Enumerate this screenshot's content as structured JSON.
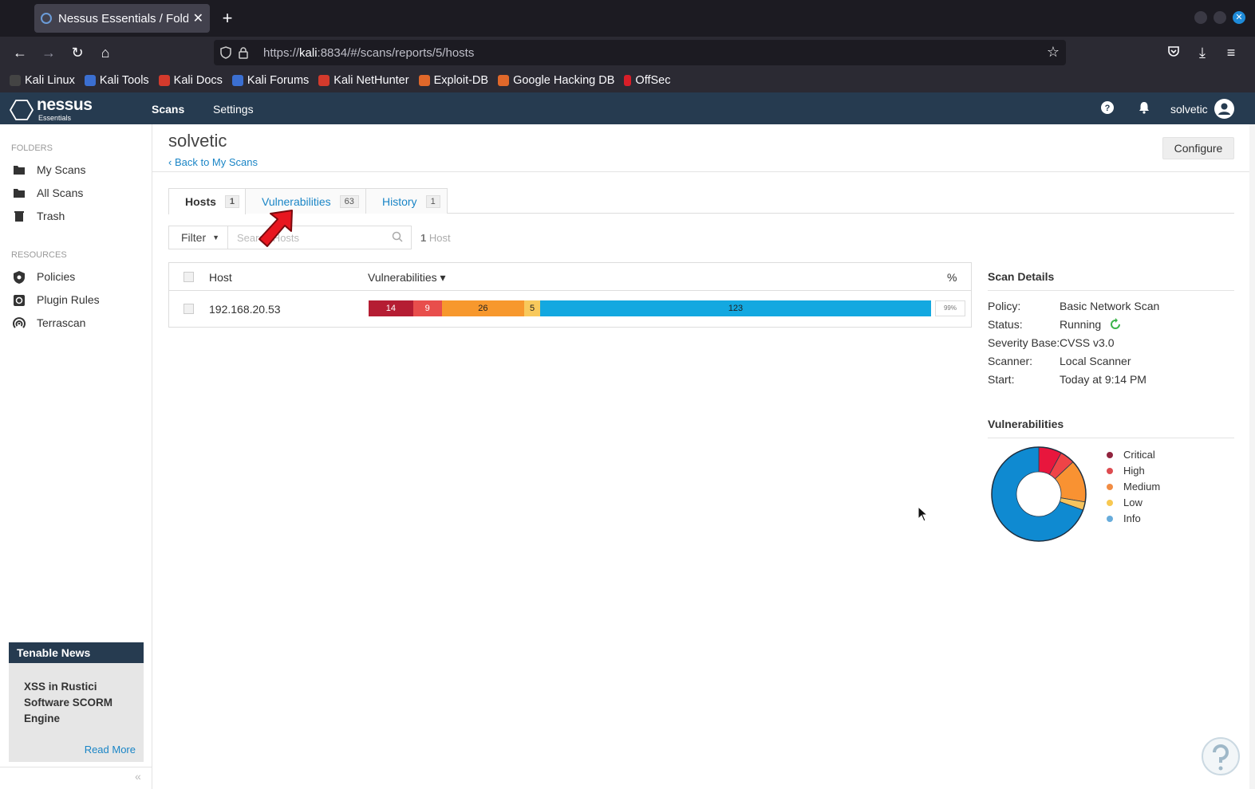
{
  "browser": {
    "tab_title": "Nessus Essentials / Folders",
    "url_prefix": "https://",
    "url_host": "kali",
    "url_rest": ":8834/#/scans/reports/5/hosts",
    "bookmarks": [
      {
        "label": "Kali Linux",
        "color": "#1b1b1b"
      },
      {
        "label": "Kali Tools",
        "color": "#3b6fd1"
      },
      {
        "label": "Kali Docs",
        "color": "#d33a2c"
      },
      {
        "label": "Kali Forums",
        "color": "#3b6fd1"
      },
      {
        "label": "Kali NetHunter",
        "color": "#d33a2c"
      },
      {
        "label": "Exploit-DB",
        "color": "#e0682a"
      },
      {
        "label": "Google Hacking DB",
        "color": "#e0682a"
      },
      {
        "label": "OffSec",
        "color": "#d81e28"
      }
    ]
  },
  "app": {
    "logo_text": "nessus",
    "logo_sub": "Essentials",
    "nav": {
      "scans": "Scans",
      "settings": "Settings"
    },
    "user": "solvetic"
  },
  "sidebar": {
    "folders_heading": "FOLDERS",
    "folders": [
      "My Scans",
      "All Scans",
      "Trash"
    ],
    "resources_heading": "RESOURCES",
    "resources": [
      "Policies",
      "Plugin Rules",
      "Terrascan"
    ],
    "news": {
      "heading": "Tenable News",
      "title": "XSS in Rustici Software SCORM Engine",
      "link": "Read More"
    }
  },
  "main": {
    "title": "solvetic",
    "back_link": "Back to My Scans",
    "configure": "Configure",
    "tabs": [
      {
        "label": "Hosts",
        "count": "1"
      },
      {
        "label": "Vulnerabilities",
        "count": "63"
      },
      {
        "label": "History",
        "count": "1"
      }
    ],
    "filter": "Filter",
    "search_placeholder": "Search Hosts",
    "host_count_num": "1",
    "host_count_label": "Host",
    "table": {
      "headers": {
        "host": "Host",
        "vulns": "Vulnerabilities ▾",
        "pct": "%"
      },
      "rows": [
        {
          "host": "192.168.20.53",
          "critical": 14,
          "high": 9,
          "medium": 26,
          "low": 5,
          "info": 123,
          "percent": "99%"
        }
      ]
    }
  },
  "scan_details": {
    "title": "Scan Details",
    "policy_label": "Policy:",
    "policy": "Basic Network Scan",
    "status_label": "Status:",
    "status": "Running",
    "severity_label": "Severity Base:",
    "severity": "CVSS v3.0",
    "scanner_label": "Scanner:",
    "scanner": "Local Scanner",
    "start_label": "Start:",
    "start": "Today at 9:14 PM"
  },
  "vulnerabilities": {
    "title": "Vulnerabilities",
    "legend": [
      {
        "label": "Critical",
        "color": "#91243e"
      },
      {
        "label": "High",
        "color": "#dd4b50"
      },
      {
        "label": "Medium",
        "color": "#f18c43"
      },
      {
        "label": "Low",
        "color": "#f8c851"
      },
      {
        "label": "Info",
        "color": "#67acdb"
      }
    ],
    "chart_data": {
      "type": "pie",
      "categories": [
        "Critical",
        "High",
        "Medium",
        "Low",
        "Info"
      ],
      "values": [
        14,
        9,
        26,
        5,
        123
      ],
      "colors": [
        "#e8163d",
        "#ef4447",
        "#f99232",
        "#f6c35d",
        "#0f8ad1"
      ]
    }
  }
}
